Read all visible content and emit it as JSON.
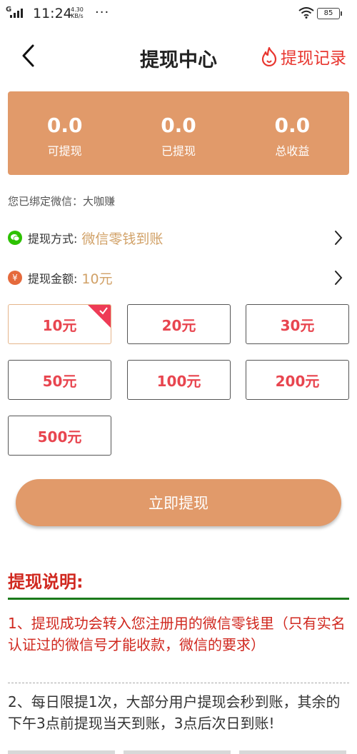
{
  "status_bar": {
    "signal": "G",
    "time": "11:24",
    "speed_value": "4.30",
    "speed_unit": "KB/s",
    "dots": "···",
    "battery": "85"
  },
  "header": {
    "title": "提现中心",
    "record_link": "提现记录"
  },
  "summary": [
    {
      "value": "0.0",
      "label": "可提现"
    },
    {
      "value": "0.0",
      "label": "已提现"
    },
    {
      "value": "0.0",
      "label": "总收益"
    }
  ],
  "bound_wechat": "您已绑定微信：大咖赚",
  "method": {
    "label": "提现方式:",
    "value": "微信零钱到账"
  },
  "amount_row": {
    "label": "提现金额:",
    "value": "10元",
    "icon_symbol": "¥"
  },
  "amounts": [
    {
      "label": "10元",
      "selected": true
    },
    {
      "label": "20元",
      "selected": false
    },
    {
      "label": "30元",
      "selected": false
    },
    {
      "label": "50元",
      "selected": false
    },
    {
      "label": "100元",
      "selected": false
    },
    {
      "label": "200元",
      "selected": false
    },
    {
      "label": "500元",
      "selected": false
    }
  ],
  "submit_label": "立即提现",
  "notes": {
    "title": "提现说明:",
    "items": [
      "1、提现成功会转入您注册用的微信零钱里（只有实名认证过的微信号才能收款，微信的要求）",
      "2、每日限提1次，大部分用户提现会秒到账，其余的下午3点前提现当天到账，3点后次日到账!"
    ]
  },
  "colors": {
    "accent": "#e19a6a",
    "red": "#e8362f",
    "gold": "#d1a167",
    "wechat_green": "#2dc100",
    "rule_green": "#1b7a1b"
  }
}
